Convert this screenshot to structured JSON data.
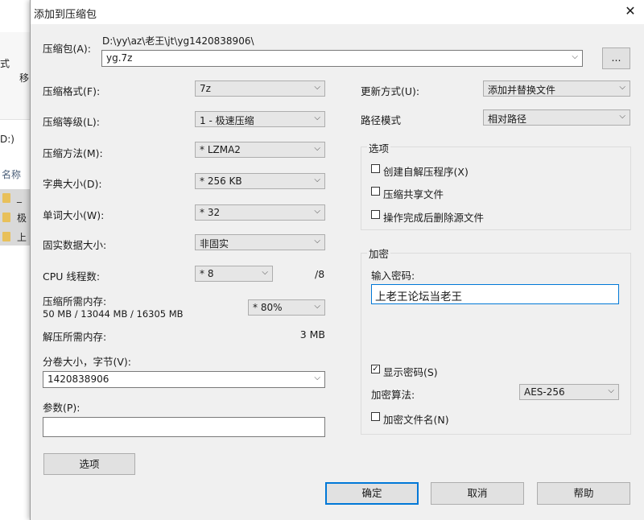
{
  "background": {
    "toolbar_text_1": "式",
    "toolbar_text_2": "移",
    "drive": "D:)",
    "column_name": "名称",
    "files": [
      "_",
      "极",
      "上"
    ]
  },
  "dialog": {
    "title": "添加到压缩包",
    "archive": {
      "label": "压缩包(A):",
      "path": "D:\\yy\\az\\老王\\jt\\yg1420838906\\",
      "name": "yg.7z",
      "browse": "..."
    },
    "left": {
      "format": {
        "label": "压缩格式(F):",
        "value": "7z"
      },
      "level": {
        "label": "压缩等级(L):",
        "value": "1 - 极速压缩"
      },
      "method": {
        "label": "压缩方法(M):",
        "value": "* LZMA2"
      },
      "dict": {
        "label": "字典大小(D):",
        "value": "* 256 KB"
      },
      "word": {
        "label": "单词大小(W):",
        "value": "* 32"
      },
      "solid": {
        "label": "固实数据大小:",
        "value": "非固实"
      },
      "cpu": {
        "label": "CPU 线程数:",
        "value": "* 8",
        "max": "/8"
      },
      "mem": {
        "label": "压缩所需内存:",
        "detail": "50 MB / 13044 MB / 16305 MB",
        "value": "* 80%"
      },
      "decomp": {
        "label": "解压所需内存:",
        "value": "3 MB"
      },
      "volume": {
        "label": "分卷大小，字节(V):",
        "value": "1420838906"
      },
      "params": {
        "label": "参数(P):",
        "value": ""
      },
      "options_button": "选项"
    },
    "right": {
      "update": {
        "label": "更新方式(U):",
        "value": "添加并替换文件"
      },
      "path_mode": {
        "label": "路径模式",
        "value": "相对路径"
      },
      "options": {
        "title": "选项",
        "sfx": {
          "label": "创建自解压程序(X)",
          "checked": false
        },
        "shared": {
          "label": "压缩共享文件",
          "checked": false
        },
        "delete": {
          "label": "操作完成后删除源文件",
          "checked": false
        }
      },
      "encryption": {
        "title": "加密",
        "password_label": "输入密码:",
        "password": "上老王论坛当老王",
        "show_password": {
          "label": "显示密码(S)",
          "checked": true
        },
        "method_label": "加密算法:",
        "method_value": "AES-256",
        "encrypt_names": {
          "label": "加密文件名(N)",
          "checked": false
        }
      }
    },
    "buttons": {
      "ok": "确定",
      "cancel": "取消",
      "help": "帮助"
    },
    "glyphs": {
      "close": "✕",
      "arrow": "⌵",
      "check": "✓"
    }
  }
}
